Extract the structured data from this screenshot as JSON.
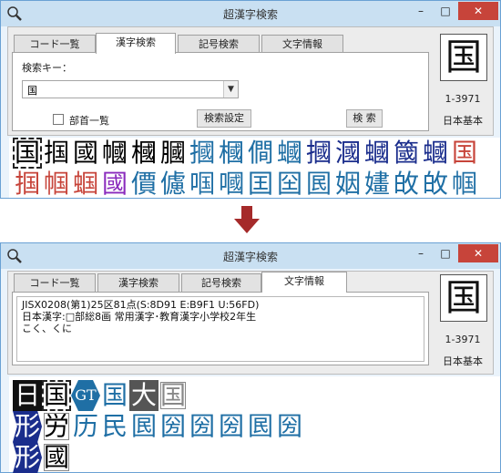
{
  "window_title": "超漢字検索",
  "window_buttons": {
    "minimize": "–",
    "maximize": "□",
    "close": "✕"
  },
  "tabs": [
    {
      "label": "コード一覧"
    },
    {
      "label": "漢字検索"
    },
    {
      "label": "記号検索"
    },
    {
      "label": "文字情報"
    }
  ],
  "search": {
    "key_label": "検索キー：",
    "key_value": "国",
    "radical_list_label": "部首一覧",
    "settings_button": "検索設定",
    "search_button": "検 索"
  },
  "selected_char": {
    "glyph": "国",
    "code": "1-3971",
    "standard": "日本基本"
  },
  "info_text": {
    "line1": "JISX0208(第1)25区81点(S:8D91 E:B9F1 U:56FD)",
    "line2": "日本漢字:□部総8画 常用漢字･教育漢字小学校2年生",
    "line3": "こく、くに"
  },
  "result_rows": [
    [
      "国",
      "掴",
      "國",
      "幗",
      "槶",
      "膕",
      "摑",
      "槶",
      "僴",
      "蟈",
      "摑",
      "漍",
      "蟈",
      "簂",
      "蟈",
      "国"
    ],
    [
      "掴",
      "帼",
      "蝈",
      "國",
      "價",
      "儢",
      "啯",
      "嘓",
      "囯",
      "囶",
      "囻",
      "姻",
      "嫿",
      "敀",
      "敀",
      "帼"
    ]
  ],
  "variant_rows": [
    [
      "日",
      "国",
      "GT",
      "国",
      "大",
      "国"
    ],
    [
      "形",
      "労",
      "历",
      "民",
      "囻",
      "圀",
      "圀",
      "圀",
      "囻",
      "圀"
    ],
    [
      "形",
      "國"
    ]
  ],
  "colors": {
    "accent": "#c7443a",
    "titlebar": "#c9e0f2",
    "blue": "#1f6fa5",
    "navy": "#1a2d8c",
    "purple": "#8a2bbd",
    "arrow": "#a52a2a"
  }
}
